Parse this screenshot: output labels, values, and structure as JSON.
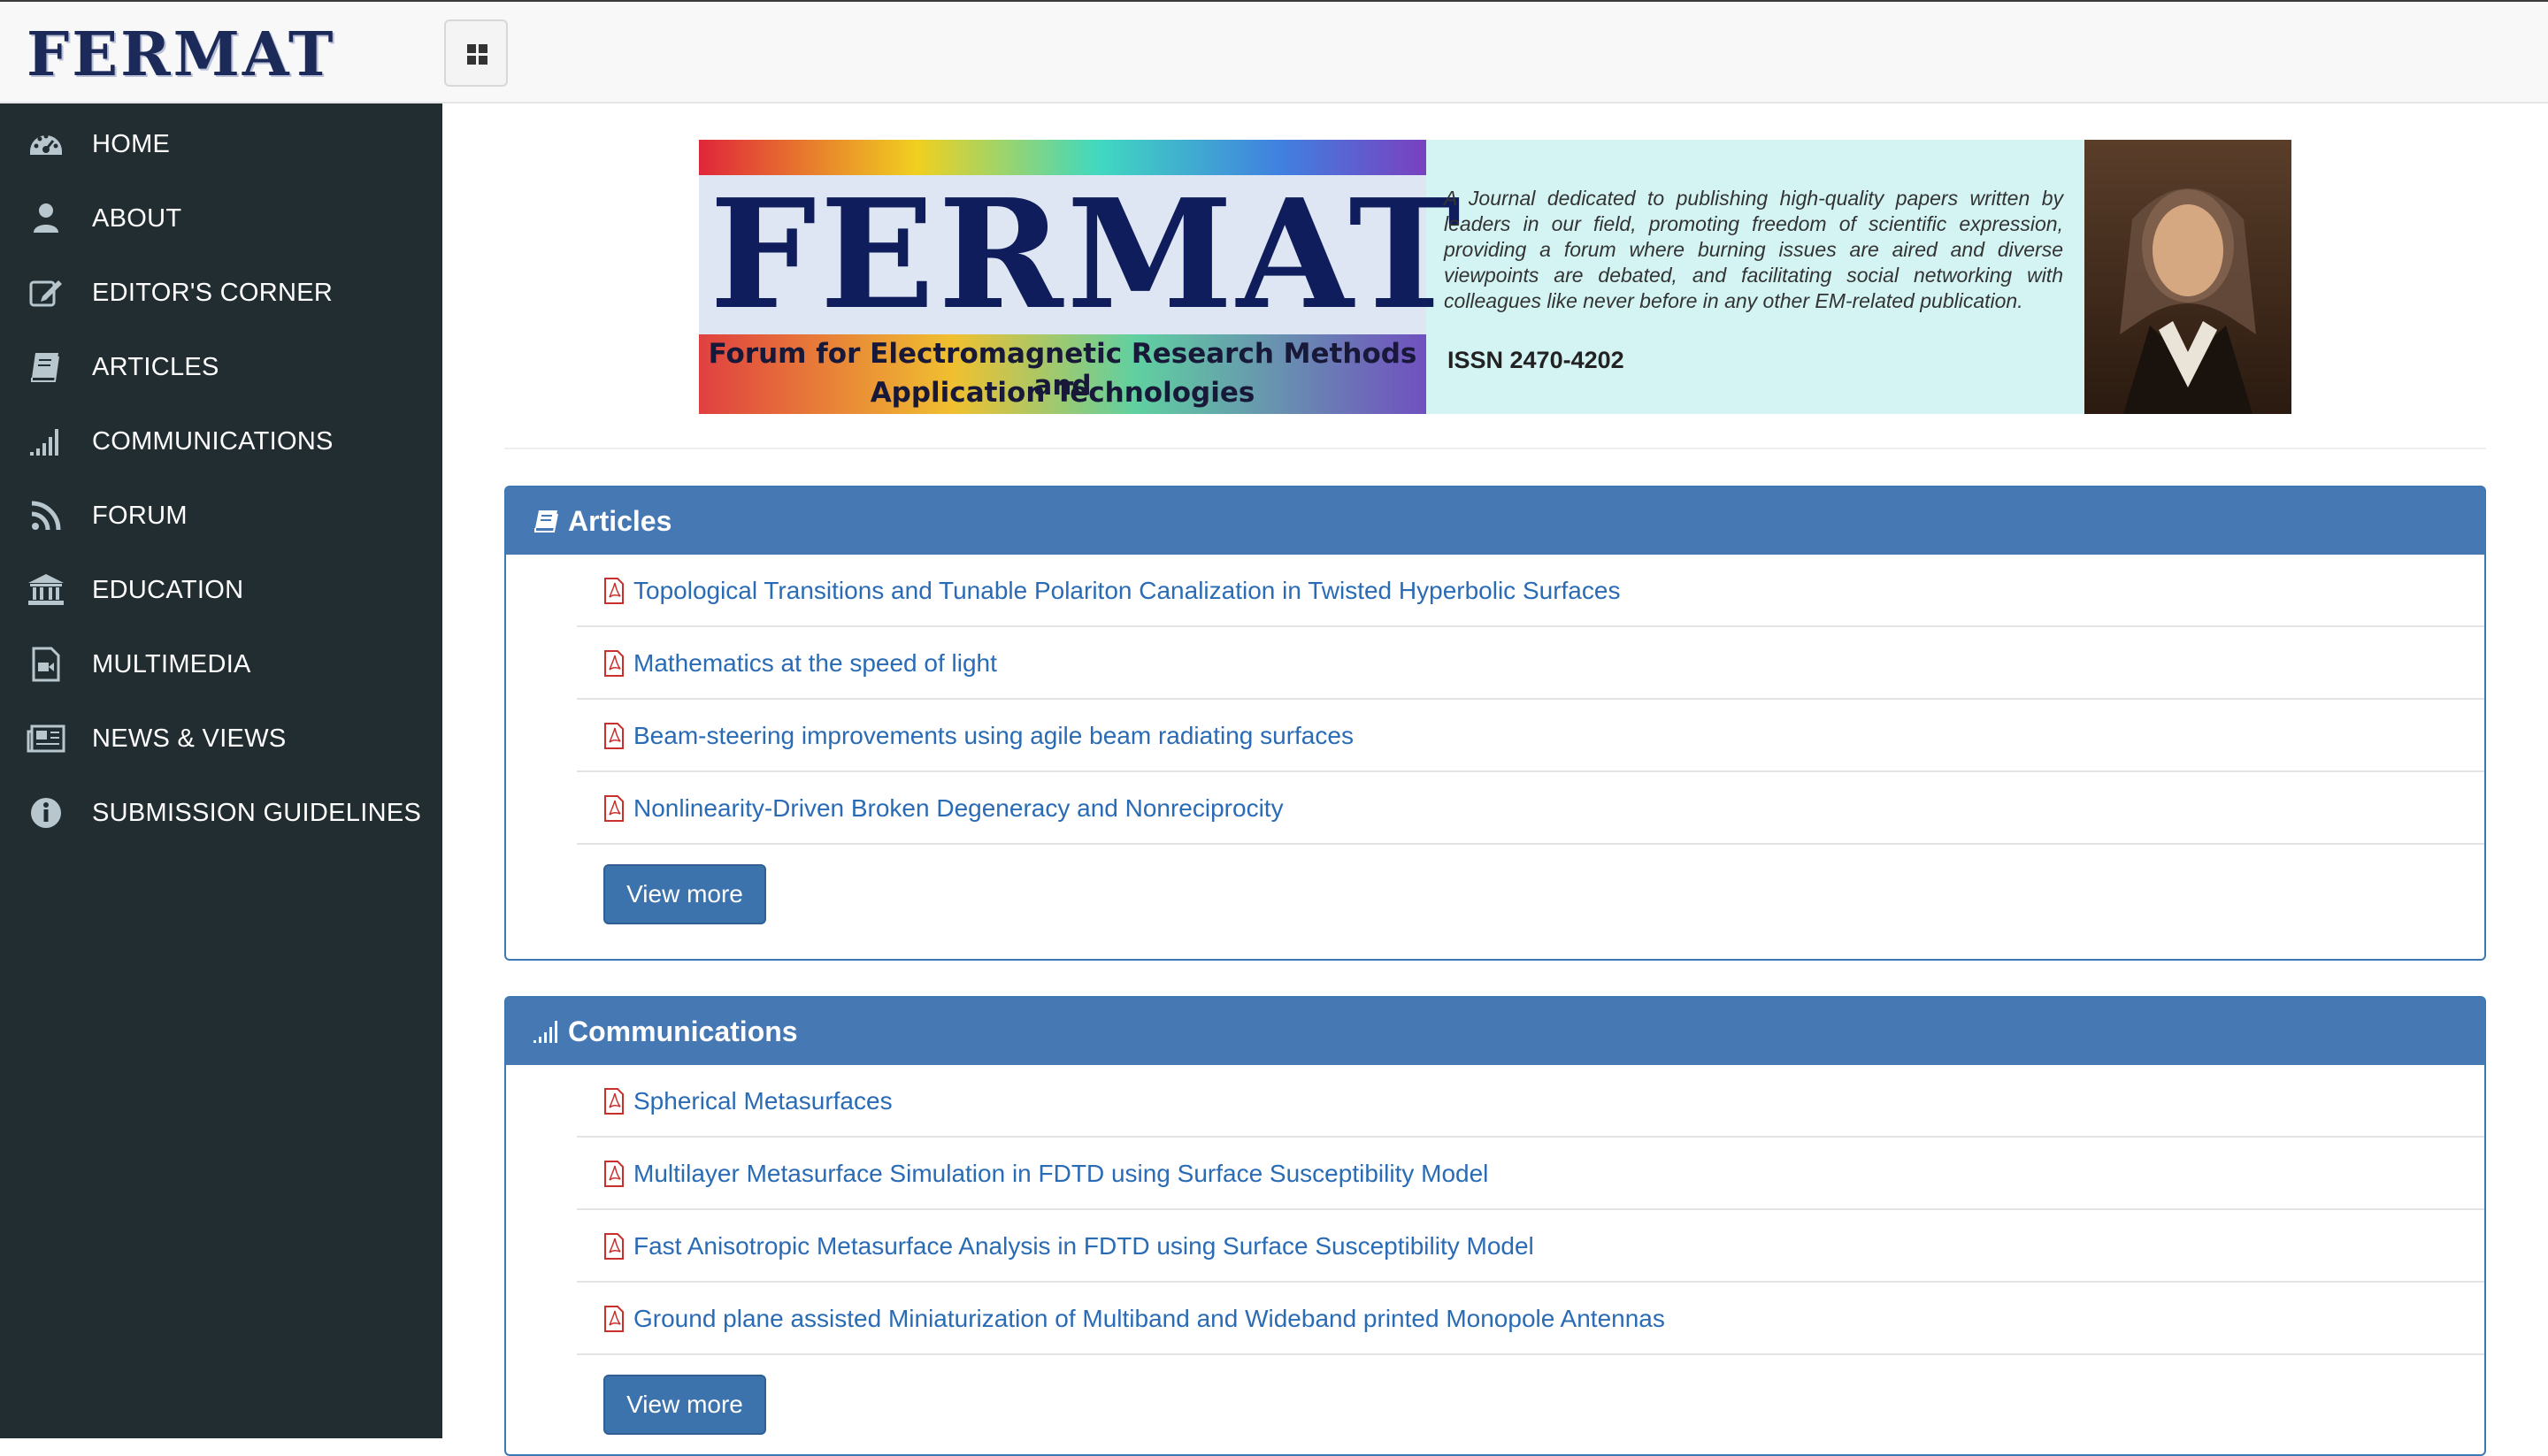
{
  "header": {
    "logo_text": "FERMAT",
    "menu_toggle_icon": "grid-icon"
  },
  "sidebar": {
    "items": [
      {
        "label": "HOME",
        "icon": "dashboard-icon"
      },
      {
        "label": "ABOUT",
        "icon": "user-icon"
      },
      {
        "label": "EDITOR'S CORNER",
        "icon": "edit-icon"
      },
      {
        "label": "ARTICLES",
        "icon": "book-icon"
      },
      {
        "label": "COMMUNICATIONS",
        "icon": "signal-icon"
      },
      {
        "label": "FORUM",
        "icon": "feed-icon"
      },
      {
        "label": "EDUCATION",
        "icon": "institution-icon"
      },
      {
        "label": "MULTIMEDIA",
        "icon": "video-file-icon"
      },
      {
        "label": "NEWS & VIEWS",
        "icon": "newspaper-icon"
      },
      {
        "label": "SUBMISSION GUIDELINES",
        "icon": "info-icon"
      }
    ]
  },
  "banner": {
    "title": "FERMAT",
    "subtitle_line1": "Forum for Electromagnetic Research Methods and",
    "subtitle_line2": "Application Technologies",
    "description": "A Journal dedicated to publishing high-quality papers written by leaders in our field,  promoting freedom of scientific expression, providing a forum where burning issues are aired and diverse viewpoints are debated, and facilitating social networking with colleagues like never before in any other EM-related publication.",
    "issn": "ISSN 2470-4202"
  },
  "articles": {
    "title": "Articles",
    "items": [
      "Topological Transitions and Tunable Polariton Canalization in Twisted Hyperbolic Surfaces",
      "Mathematics at the speed of light",
      "Beam-steering improvements using agile beam radiating surfaces",
      "Nonlinearity-Driven Broken Degeneracy and Nonreciprocity"
    ],
    "more_label": "View more"
  },
  "communications": {
    "title": "Communications",
    "items": [
      "Spherical Metasurfaces",
      "Multilayer Metasurface Simulation in FDTD using Surface Susceptibility Model",
      "Fast Anisotropic Metasurface Analysis in FDTD using Surface Susceptibility Model",
      "Ground plane assisted Miniaturization of Multiband and Wideband printed Monopole Antennas"
    ],
    "more_label": "View more"
  },
  "colors": {
    "sidebar_bg": "#222d32",
    "panel_header": "#4679b3",
    "link": "#2a6bb5",
    "pdf_icon": "#c9302c"
  }
}
